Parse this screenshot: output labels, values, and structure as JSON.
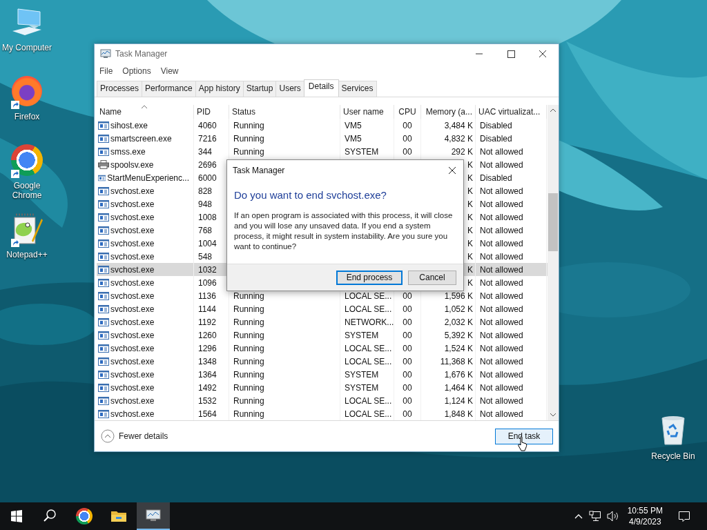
{
  "desktop_icons": [
    {
      "label": "My Computer",
      "kind": "computer",
      "shortcut": false
    },
    {
      "label": "Firefox",
      "kind": "firefox",
      "shortcut": true
    },
    {
      "label": "Google Chrome",
      "kind": "chrome",
      "shortcut": true
    },
    {
      "label": "Notepad++",
      "kind": "notepad",
      "shortcut": true
    }
  ],
  "recycle_bin": {
    "label": "Recycle Bin"
  },
  "window": {
    "title": "Task Manager",
    "menu": [
      "File",
      "Options",
      "View"
    ],
    "tabs": [
      {
        "label": "Processes",
        "selected": false
      },
      {
        "label": "Performance",
        "selected": false
      },
      {
        "label": "App history",
        "selected": false
      },
      {
        "label": "Startup",
        "selected": false
      },
      {
        "label": "Users",
        "selected": false
      },
      {
        "label": "Details",
        "selected": true
      },
      {
        "label": "Services",
        "selected": false
      }
    ],
    "columns": [
      {
        "label": "Name",
        "sorted": true
      },
      {
        "label": "PID",
        "sorted": false
      },
      {
        "label": "Status",
        "sorted": false
      },
      {
        "label": "User name",
        "sorted": false
      },
      {
        "label": "CPU",
        "sorted": false
      },
      {
        "label": "Memory (a...",
        "sorted": false
      },
      {
        "label": "UAC virtualizat...",
        "sorted": false
      }
    ],
    "rows": [
      {
        "kind": "app",
        "name": "sihost.exe",
        "pid": "4060",
        "status": "Running",
        "user_name": "VM5",
        "cpu": "00",
        "memory": "3,484 K",
        "uac_virtualization": "Disabled",
        "selected": false
      },
      {
        "kind": "app",
        "name": "smartscreen.exe",
        "pid": "7216",
        "status": "Running",
        "user_name": "VM5",
        "cpu": "00",
        "memory": "4,832 K",
        "uac_virtualization": "Disabled",
        "selected": false
      },
      {
        "kind": "app",
        "name": "smss.exe",
        "pid": "344",
        "status": "Running",
        "user_name": "SYSTEM",
        "cpu": "00",
        "memory": "292 K",
        "uac_virtualization": "Not allowed",
        "selected": false
      },
      {
        "kind": "printer",
        "name": "spoolsv.exe",
        "pid": "2696",
        "memory": "K",
        "uac_virtualization": "Not allowed",
        "selected": false
      },
      {
        "kind": "app",
        "name": "StartMenuExperienc...",
        "pid": "6000",
        "memory": "K",
        "uac_virtualization": "Disabled",
        "selected": false
      },
      {
        "kind": "app",
        "name": "svchost.exe",
        "pid": "828",
        "memory": "K",
        "uac_virtualization": "Not allowed",
        "selected": false
      },
      {
        "kind": "app",
        "name": "svchost.exe",
        "pid": "948",
        "memory": "K",
        "uac_virtualization": "Not allowed",
        "selected": false
      },
      {
        "kind": "app",
        "name": "svchost.exe",
        "pid": "1008",
        "memory": "K",
        "uac_virtualization": "Not allowed",
        "selected": false
      },
      {
        "kind": "app",
        "name": "svchost.exe",
        "pid": "768",
        "memory": "K",
        "uac_virtualization": "Not allowed",
        "selected": false
      },
      {
        "kind": "app",
        "name": "svchost.exe",
        "pid": "1004",
        "memory": "K",
        "uac_virtualization": "Not allowed",
        "selected": false
      },
      {
        "kind": "app",
        "name": "svchost.exe",
        "pid": "548",
        "memory": "K",
        "uac_virtualization": "Not allowed",
        "selected": false
      },
      {
        "kind": "app",
        "name": "svchost.exe",
        "pid": "1032",
        "memory": "K",
        "uac_virtualization": "Not allowed",
        "selected": true
      },
      {
        "kind": "app",
        "name": "svchost.exe",
        "pid": "1096",
        "memory": "K",
        "uac_virtualization": "Not allowed",
        "selected": false
      },
      {
        "kind": "app",
        "name": "svchost.exe",
        "pid": "1136",
        "status": "Running",
        "user_name": "LOCAL SE...",
        "cpu": "00",
        "memory": "1,596 K",
        "uac_virtualization": "Not allowed",
        "selected": false
      },
      {
        "kind": "app",
        "name": "svchost.exe",
        "pid": "1144",
        "status": "Running",
        "user_name": "LOCAL SE...",
        "cpu": "00",
        "memory": "1,052 K",
        "uac_virtualization": "Not allowed",
        "selected": false
      },
      {
        "kind": "app",
        "name": "svchost.exe",
        "pid": "1192",
        "status": "Running",
        "user_name": "NETWORK...",
        "cpu": "00",
        "memory": "2,032 K",
        "uac_virtualization": "Not allowed",
        "selected": false
      },
      {
        "kind": "app",
        "name": "svchost.exe",
        "pid": "1260",
        "status": "Running",
        "user_name": "SYSTEM",
        "cpu": "00",
        "memory": "5,392 K",
        "uac_virtualization": "Not allowed",
        "selected": false
      },
      {
        "kind": "app",
        "name": "svchost.exe",
        "pid": "1296",
        "status": "Running",
        "user_name": "LOCAL SE...",
        "cpu": "00",
        "memory": "1,524 K",
        "uac_virtualization": "Not allowed",
        "selected": false
      },
      {
        "kind": "app",
        "name": "svchost.exe",
        "pid": "1348",
        "status": "Running",
        "user_name": "LOCAL SE...",
        "cpu": "00",
        "memory": "11,368 K",
        "uac_virtualization": "Not allowed",
        "selected": false
      },
      {
        "kind": "app",
        "name": "svchost.exe",
        "pid": "1364",
        "status": "Running",
        "user_name": "SYSTEM",
        "cpu": "00",
        "memory": "1,676 K",
        "uac_virtualization": "Not allowed",
        "selected": false
      },
      {
        "kind": "app",
        "name": "svchost.exe",
        "pid": "1492",
        "status": "Running",
        "user_name": "SYSTEM",
        "cpu": "00",
        "memory": "1,464 K",
        "uac_virtualization": "Not allowed",
        "selected": false
      },
      {
        "kind": "app",
        "name": "svchost.exe",
        "pid": "1532",
        "status": "Running",
        "user_name": "LOCAL SE...",
        "cpu": "00",
        "memory": "1,124 K",
        "uac_virtualization": "Not allowed",
        "selected": false
      },
      {
        "kind": "app",
        "name": "svchost.exe",
        "pid": "1564",
        "status": "Running",
        "user_name": "LOCAL SE...",
        "cpu": "00",
        "memory": "1,848 K",
        "uac_virtualization": "Not allowed",
        "selected": false
      }
    ],
    "fewer_details": "Fewer details",
    "end_task": "End task"
  },
  "dialog": {
    "title": "Task Manager",
    "heading": "Do you want to end svchost.exe?",
    "message": "If an open program is associated with this process, it will close and you will lose any unsaved data. If you end a system process, it might result in system instability. Are you sure you want to continue?",
    "buttons": [
      {
        "label": "End process",
        "selected": true
      },
      {
        "label": "Cancel",
        "selected": false
      }
    ]
  },
  "taskbar": {
    "apps": [
      {
        "kind": "chrome",
        "active": false
      },
      {
        "kind": "explorer",
        "active": false
      },
      {
        "kind": "taskmanager",
        "active": true
      }
    ],
    "time": "10:55 PM",
    "date": "4/9/2023"
  }
}
